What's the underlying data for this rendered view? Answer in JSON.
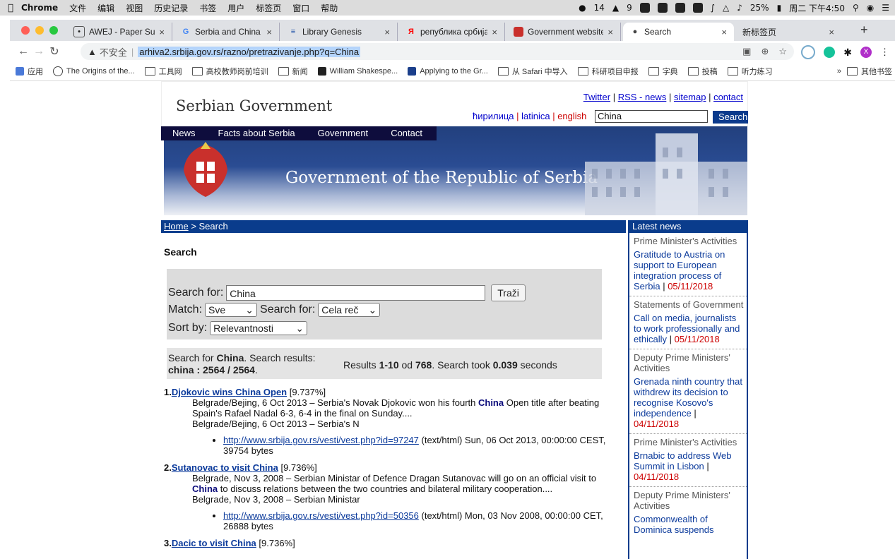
{
  "menubar": {
    "app": "Chrome",
    "items": [
      "文件",
      "编辑",
      "视图",
      "历史记录",
      "书签",
      "用户",
      "标签页",
      "窗口",
      "帮助"
    ],
    "wechat_count": "14",
    "notif_count": "9",
    "battery": "25%",
    "clock": "周二 下午4:50"
  },
  "tabs": [
    {
      "title": "AWEJ - Paper Submi",
      "icon": "awej-icon",
      "color": "#555555"
    },
    {
      "title": "Serbia and China - G",
      "icon": "google-icon",
      "color": "#4285f4"
    },
    {
      "title": "Library Genesis",
      "icon": "libgen-icon",
      "color": "#2255aa"
    },
    {
      "title": "република србија – ",
      "icon": "yandex-icon",
      "color": "#ff0000"
    },
    {
      "title": "Government website",
      "icon": "serbia-crest-icon",
      "color": "#c9302c"
    },
    {
      "title": "Search",
      "icon": "globe-icon",
      "color": "#444444"
    },
    {
      "title": "新标签页",
      "icon": "",
      "color": ""
    }
  ],
  "omnibox": {
    "insecure": "不安全",
    "url": "arhiva2.srbija.gov.rs/razno/pretrazivanje.php?q=China"
  },
  "bookmarks": [
    {
      "label": "应用"
    },
    {
      "label": "The Origins of the..."
    },
    {
      "label": "工具网"
    },
    {
      "label": "高校教师岗前培训"
    },
    {
      "label": "新闻"
    },
    {
      "label": "William Shakespe..."
    },
    {
      "label": "Applying to the Gr..."
    },
    {
      "label": "从 Safari 中导入"
    },
    {
      "label": "科研项目申报"
    },
    {
      "label": "字典"
    },
    {
      "label": "投稿"
    },
    {
      "label": "听力练习"
    }
  ],
  "bookmarks_more": "»",
  "bookmarks_other": "其他书签",
  "site": {
    "name": "Serbian Government",
    "toplinks": [
      "Twitter",
      "RSS - news",
      "sitemap",
      "contact"
    ],
    "lang_cyr": "ћирилица",
    "lang_lat": "latinica",
    "lang_en": "english",
    "search_value": "China",
    "search_btn": "Search",
    "nav": [
      "News",
      "Facts about Serbia",
      "Government",
      "Contact"
    ],
    "banner_title": "Government of the Republic of Serbia"
  },
  "breadcrumb": {
    "home": "Home",
    "current": "> Search"
  },
  "heading": "Search",
  "form": {
    "search_for_label": "Search for:",
    "query": "China",
    "submit": "Traži",
    "match_label": "Match:",
    "match_value": "Sve",
    "search_for2_label": "Search for:",
    "search_for2_value": "Cela reč",
    "sort_label": "Sort by:",
    "sort_value": "Relevantnosti"
  },
  "info": {
    "p1": "Search for ",
    "term": "China",
    "p2": ". Search results:",
    "count": "china : 2564 / 2564",
    "dot": ".",
    "results_pre": "Results ",
    "range": "1-10",
    "od": " od ",
    "total": "768",
    "took": ". Search took ",
    "seconds_val": "0.039",
    "seconds": " seconds"
  },
  "results": [
    {
      "num": "1.",
      "title_pre": "Djokovic wins ",
      "title_bold": "China",
      "title_post": " Open",
      "rank": "[9.737%]",
      "snip_a": "Belgrade/Bejing, 6 Oct 2013 – Serbia's Novak Djokovic won his fourth ",
      "snip_b": "China",
      "snip_c": " Open title after beating Spain's Rafael Nadal 6-3, 6-4 in the final on Sunday....",
      "snip_d": "Belgrade/Bejing, 6 Oct 2013 – Serbia's N",
      "link": "http://www.srbija.gov.rs/vesti/vest.php?id=97247",
      "meta": " (text/html) Sun, 06 Oct 2013, 00:00:00 CEST, 39754 bytes"
    },
    {
      "num": "2.",
      "title_pre": "Sutanovac to visit ",
      "title_bold": "China",
      "title_post": "",
      "rank": "[9.736%]",
      "snip_a": "Belgrade, Nov 3, 2008 – Serbian Ministar of Defence Dragan Sutanovac will go on an official visit to ",
      "snip_b": "China",
      "snip_c": " to discuss relations between the two countries and bilateral military cooperation....",
      "snip_d": "Belgrade, Nov 3, 2008 – Serbian Ministar",
      "link": "http://www.srbija.gov.rs/vesti/vest.php?id=50356",
      "meta": " (text/html) Mon, 03 Nov 2008, 00:00:00 CET, 26888 bytes"
    },
    {
      "num": "3.",
      "title_pre": "Dacic to visit ",
      "title_bold": "China",
      "title_post": "",
      "rank": "[9.736%]"
    }
  ],
  "sidebar": {
    "heading": "Latest news",
    "items": [
      {
        "cat": "Prime Minister's Activities",
        "hl": "Gratitude to Austria on support to European integration process of Serbia",
        "date": "05/11/2018"
      },
      {
        "cat": "Statements of Government",
        "hl": "Call on media, journalists to work professionally and ethically",
        "date": "05/11/2018"
      },
      {
        "cat": "Deputy Prime Ministers' Activities",
        "hl": "Grenada ninth country that withdrew its decision to recognise Kosovo's independence",
        "date": "04/11/2018"
      },
      {
        "cat": "Prime Minister's Activities",
        "hl": "Brnabic to address Web Summit in Lisbon",
        "date": "04/11/2018"
      },
      {
        "cat": "Deputy Prime Ministers' Activities",
        "hl": "Commonwealth of Dominica suspends",
        "date": ""
      }
    ]
  },
  "colors": {
    "accent": "#0a3c8c",
    "nav_dark": "#0e0d3d",
    "date_red": "#cc0000",
    "link": "#0b3a9b"
  }
}
